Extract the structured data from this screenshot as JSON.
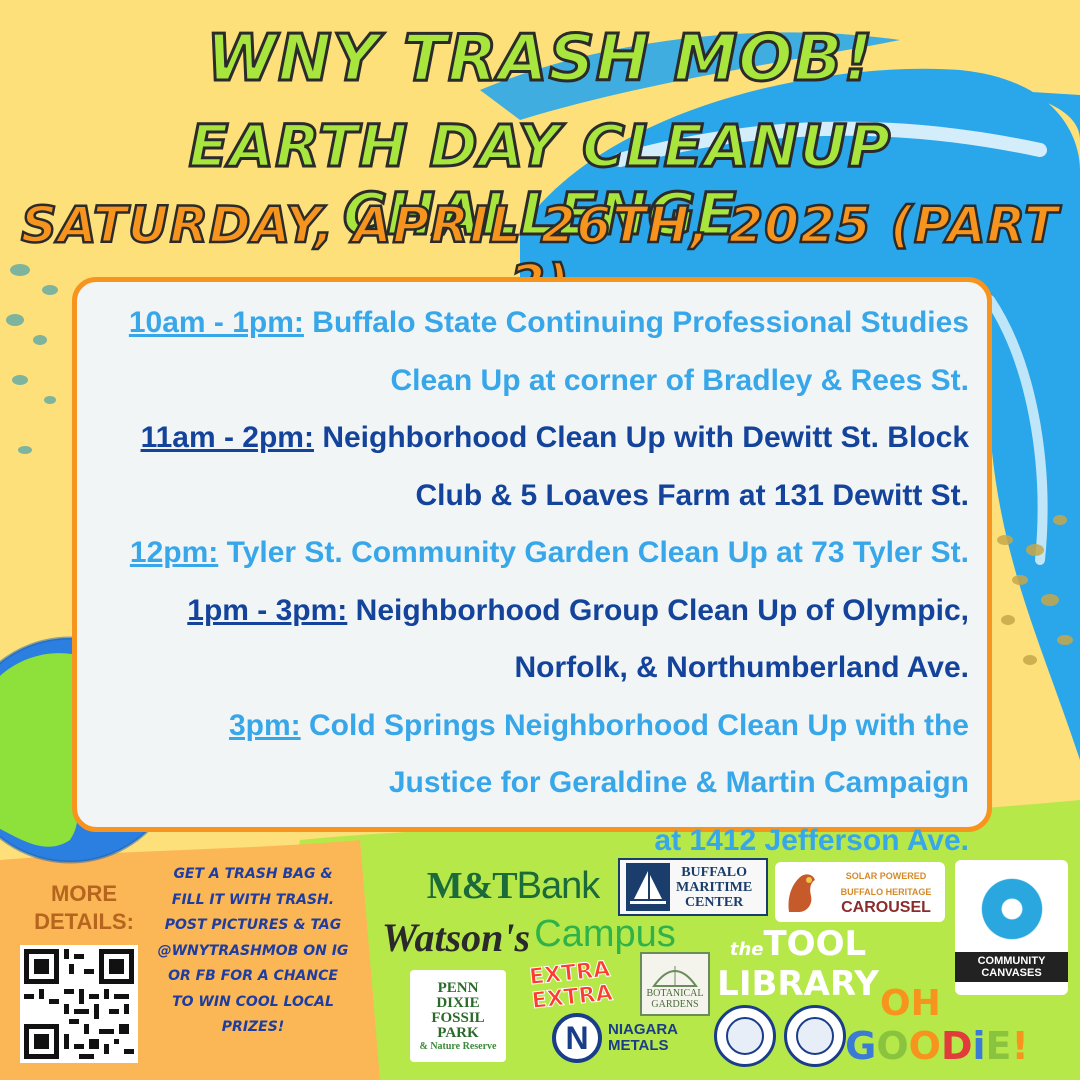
{
  "colors": {
    "background": "#fde07a",
    "accent_blue": "#2aa7ea",
    "accent_green": "#b7e84a",
    "accent_orange": "#f7941d",
    "title_green": "#a8e63e",
    "schedule_light": "#38a7ea",
    "schedule_dark": "#14439b"
  },
  "header": {
    "line1": "WNY TRASH MOB!",
    "line2": "EARTH DAY CLEANUP CHALLENGE",
    "line3": "SATURDAY, APRIL 26TH, 2025 (PART 2)"
  },
  "schedule": [
    {
      "time": "10am - 1pm:",
      "line1": "Buffalo State Continuing Professional Studies",
      "line2": "Clean Up at corner of Bradley & Rees St.",
      "style": "light"
    },
    {
      "time": "11am - 2pm:",
      "line1": "Neighborhood Clean Up with Dewitt St. Block",
      "line2": "Club & 5 Loaves Farm at 131 Dewitt St.",
      "style": "dark"
    },
    {
      "time": "12pm:",
      "line1": "Tyler St. Community Garden Clean Up at 73 Tyler St.",
      "style": "light"
    },
    {
      "time": "1pm - 3pm:",
      "line1": "Neighborhood Group Clean Up of Olympic,",
      "line2": "Norfolk, & Northumberland Ave.",
      "style": "dark"
    },
    {
      "time": "3pm:",
      "line1": "Cold Springs Neighborhood Clean Up with the",
      "line2": "Justice for Geraldine & Martin Campaign",
      "line3": "at 1412 Jefferson Ave.",
      "style": "light"
    }
  ],
  "footer": {
    "more_details": "MORE DETAILS:",
    "promo": [
      "GET A TRASH BAG &",
      "FILL IT WITH TRASH.",
      "POST PICTURES & TAG",
      "@WNYTRASHMOB ON IG",
      "OR FB FOR A CHANCE",
      "TO WIN COOL LOCAL",
      "PRIZES!"
    ]
  },
  "sponsors": {
    "mt": [
      "M&T",
      "Bank"
    ],
    "maritime": [
      "BUFFALO",
      "MARITIME",
      "CENTER"
    ],
    "carousel": [
      "SOLAR POWERED",
      "BUFFALO HERITAGE",
      "CAROUSEL"
    ],
    "community": "COMMUNITY CANVASES",
    "watsons": "Watson's",
    "campus": "Campus",
    "tool": [
      "the",
      "TOOL",
      "LIBRARY"
    ],
    "penn": [
      "PENN",
      "DIXIE",
      "FOSSIL PARK",
      "& Nature Reserve"
    ],
    "extra": [
      "EXTRA",
      "EXTRA"
    ],
    "botanical": [
      "BOTANICAL",
      "GARDENS"
    ],
    "niagara": [
      "NIAGARA",
      "METALS"
    ],
    "ohgoodie": [
      "OH",
      "GOODiE!"
    ]
  }
}
